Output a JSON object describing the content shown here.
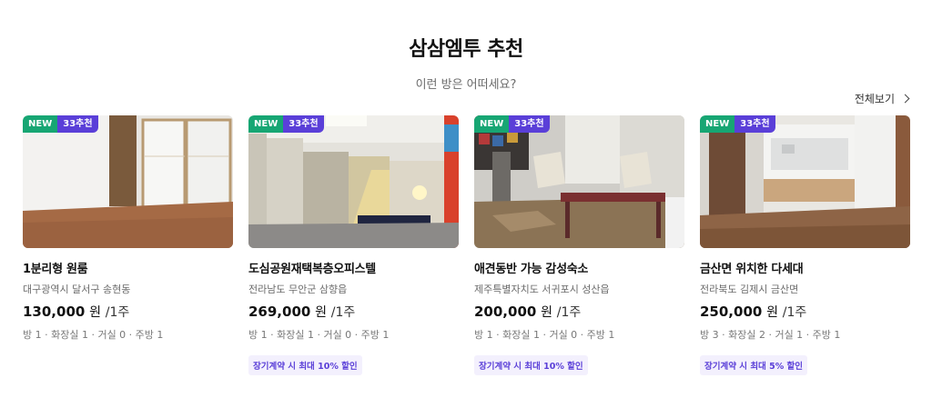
{
  "section": {
    "title": "삼삼엠투 추천",
    "subtitle": "이런 방은 어떠세요?",
    "view_all_label": "전체보기"
  },
  "listings": [
    {
      "badge_new": "NEW",
      "badge_recommend": "33추천",
      "name": "1분리형 원룸",
      "address": "대구광역시 달서구 송현동",
      "price": "130,000",
      "currency": "원",
      "period": "/1주",
      "rooms": "방 1 · 화장실 1 · 거실 0 · 주방 1",
      "promo": ""
    },
    {
      "badge_new": "NEW",
      "badge_recommend": "33추천",
      "name": "도심공원재택복층오피스텔",
      "address": "전라남도 무안군 삼향읍",
      "price": "269,000",
      "currency": "원",
      "period": "/1주",
      "rooms": "방 1 · 화장실 1 · 거실 0 · 주방 1",
      "promo": "장기계약 시 최대 10% 할인"
    },
    {
      "badge_new": "NEW",
      "badge_recommend": "33추천",
      "name": "애견동반 가능 감성숙소",
      "address": "제주특별자치도 서귀포시 성산읍",
      "price": "200,000",
      "currency": "원",
      "period": "/1주",
      "rooms": "방 1 · 화장실 1 · 거실 0 · 주방 1",
      "promo": "장기계약 시 최대 10% 할인"
    },
    {
      "badge_new": "NEW",
      "badge_recommend": "33추천",
      "name": "금산면 위치한 다세대",
      "address": "전라북도 김제시 금산면",
      "price": "250,000",
      "currency": "원",
      "period": "/1주",
      "rooms": "방 3 · 화장실 2 · 거실 1 · 주방 1",
      "promo": "장기계약 시 최대 5% 할인"
    }
  ],
  "colors": {
    "badge_new": "#17a673",
    "badge_recommend": "#5a3fd8",
    "promo_bg": "#f3f0fd",
    "promo_text": "#5a3fd8"
  }
}
